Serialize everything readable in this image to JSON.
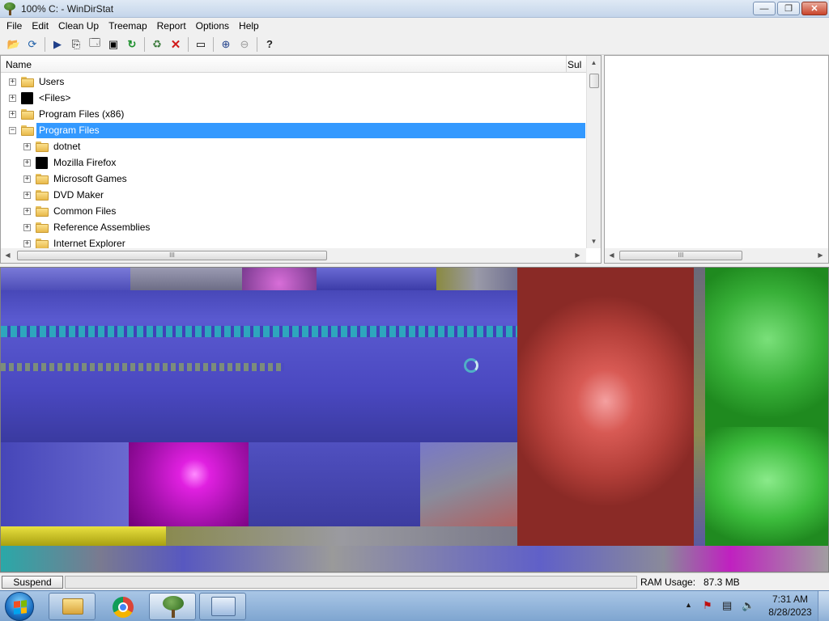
{
  "window": {
    "title": "100% C: - WinDirStat",
    "controls": {
      "minimize": "—",
      "maximize": "❐",
      "close": "✕"
    }
  },
  "menu": [
    "File",
    "Edit",
    "Clean Up",
    "Treemap",
    "Report",
    "Options",
    "Help"
  ],
  "toolbar": {
    "buttons": [
      {
        "name": "open-icon",
        "glyph": "📂"
      },
      {
        "name": "refresh-all-icon",
        "glyph": "⟳"
      },
      {
        "name": "select-drive-icon",
        "glyph": "▶"
      },
      {
        "name": "copy-path-icon",
        "glyph": "⎘"
      },
      {
        "name": "explorer-here-icon",
        "glyph": "🗔"
      },
      {
        "name": "command-prompt-icon",
        "glyph": "▣"
      },
      {
        "name": "refresh-selected-icon",
        "glyph": "↻"
      },
      {
        "name": "recycle-bin-icon",
        "glyph": "♻"
      },
      {
        "name": "delete-icon",
        "glyph": "✕"
      },
      {
        "name": "properties-icon",
        "glyph": "▭"
      },
      {
        "name": "zoom-in-icon",
        "glyph": "⊕"
      },
      {
        "name": "zoom-out-icon",
        "glyph": "⊖"
      },
      {
        "name": "help-icon",
        "glyph": "?"
      }
    ]
  },
  "tree": {
    "columns": {
      "name": "Name",
      "subtree": "Sul"
    },
    "rows": [
      {
        "label": "Users",
        "level": 0,
        "icon": "folder",
        "expander": "+",
        "selected": false
      },
      {
        "label": "<Files>",
        "level": 0,
        "icon": "black",
        "expander": "+",
        "selected": false
      },
      {
        "label": "Program Files (x86)",
        "level": 0,
        "icon": "folder",
        "expander": "+",
        "selected": false
      },
      {
        "label": "Program Files",
        "level": 0,
        "icon": "folder",
        "expander": "−",
        "selected": true
      },
      {
        "label": "dotnet",
        "level": 1,
        "icon": "folder",
        "expander": "+",
        "selected": false
      },
      {
        "label": "Mozilla Firefox",
        "level": 1,
        "icon": "black",
        "expander": "+",
        "selected": false
      },
      {
        "label": "Microsoft Games",
        "level": 1,
        "icon": "folder",
        "expander": "+",
        "selected": false
      },
      {
        "label": "DVD Maker",
        "level": 1,
        "icon": "folder",
        "expander": "+",
        "selected": false
      },
      {
        "label": "Common Files",
        "level": 1,
        "icon": "folder",
        "expander": "+",
        "selected": false
      },
      {
        "label": "Reference Assemblies",
        "level": 1,
        "icon": "folder",
        "expander": "+",
        "selected": false
      },
      {
        "label": "Internet Explorer",
        "level": 1,
        "icon": "folder",
        "expander": "+",
        "selected": false
      }
    ],
    "scroll_grip": "III"
  },
  "ext_list": {
    "scroll_grip": "III"
  },
  "status": {
    "suspend_label": "Suspend",
    "ram_label": "RAM Usage:",
    "ram_value": "87.3 MB"
  },
  "taskbar": {
    "apps": [
      "windows-explorer",
      "google-chrome",
      "windirstat",
      "control-panel"
    ],
    "clock_time": "7:31 AM",
    "clock_date": "8/28/2023",
    "tray_glyphs": {
      "up_arrow": "▲",
      "action_center": "⚑",
      "network": "▤",
      "volume": "🔈"
    }
  },
  "colors": {
    "selection": "#3399ff",
    "treemap_blue": "#5454c8",
    "treemap_red": "#c0463f",
    "treemap_green": "#34c23f",
    "treemap_magenta": "#d81ed8",
    "treemap_yellow": "#c8c020",
    "treemap_cyan": "#28b8b0"
  }
}
